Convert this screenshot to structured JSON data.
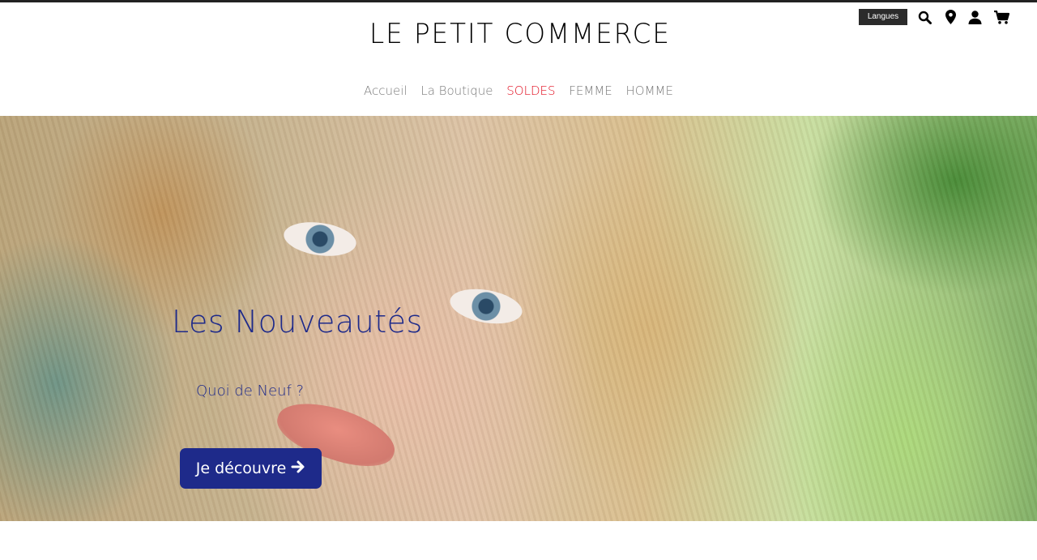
{
  "header": {
    "logo_text": "LE PETIT COMMERCE",
    "languages_label": "Langues",
    "icons": [
      "search-icon",
      "location-pin-icon",
      "user-icon",
      "cart-icon"
    ]
  },
  "nav": {
    "items": [
      {
        "label": "Accueil"
      },
      {
        "label": "La Boutique"
      },
      {
        "label": "SOLDES"
      },
      {
        "label": "FEMME"
      },
      {
        "label": "HOMME"
      }
    ]
  },
  "hero": {
    "title": "Les Nouveautés",
    "subtitle": "Quoi de Neuf ?",
    "button_label": "Je découvre",
    "button_icon": "arrow-right-icon"
  },
  "colors": {
    "accent": "#1e2a8a",
    "sale": "#e10a1c",
    "nav_text": "#7a7a7a"
  }
}
